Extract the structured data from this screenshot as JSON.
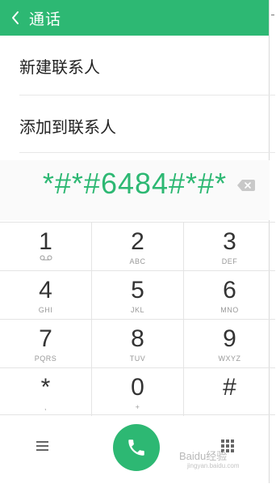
{
  "header": {
    "title": "通话"
  },
  "actions": {
    "new_contact": "新建联系人",
    "add_to_contact": "添加到联系人"
  },
  "dial": {
    "number": "*#*#6484#*#*"
  },
  "keys": [
    {
      "digit": "1",
      "letters": ""
    },
    {
      "digit": "2",
      "letters": "ABC"
    },
    {
      "digit": "3",
      "letters": "DEF"
    },
    {
      "digit": "4",
      "letters": "GHI"
    },
    {
      "digit": "5",
      "letters": "JKL"
    },
    {
      "digit": "6",
      "letters": "MNO"
    },
    {
      "digit": "7",
      "letters": "PQRS"
    },
    {
      "digit": "8",
      "letters": "TUV"
    },
    {
      "digit": "9",
      "letters": "WXYZ"
    },
    {
      "digit": "*",
      "letters": ","
    },
    {
      "digit": "0",
      "letters": "+"
    },
    {
      "digit": "#",
      "letters": ""
    }
  ],
  "watermark": {
    "text": "Baidu经验",
    "url": "jingyan.baidu.com"
  },
  "colors": {
    "accent": "#2db873"
  }
}
